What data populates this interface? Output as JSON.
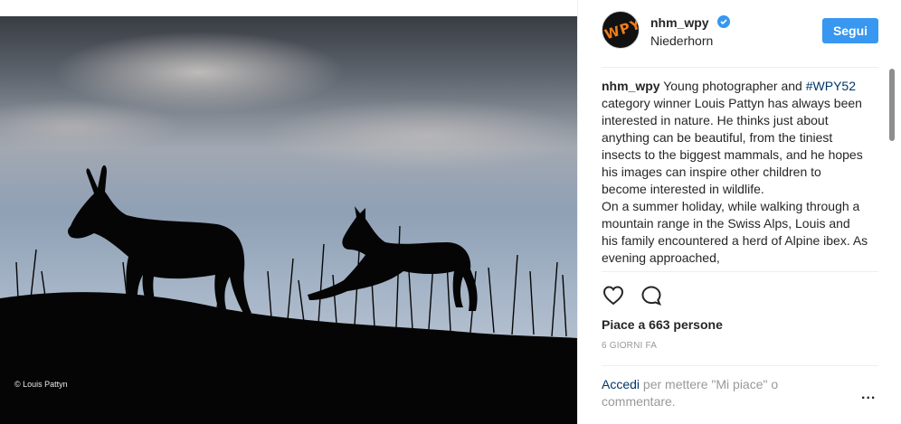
{
  "photo": {
    "credit": "© Louis Pattyn"
  },
  "post": {
    "avatar_text": "WPY",
    "username": "nhm_wpy",
    "verified_icon": "verified-badge-icon",
    "location": "Niederhorn",
    "follow_label": "Segui",
    "caption": {
      "user": "nhm_wpy",
      "lead": " Young photographer and ",
      "hashtag": "#WPY52",
      "body1": " category winner Louis Pattyn has always been interested in nature. He thinks just about anything can be beautiful, from the tiniest insects to the biggest mammals, and he hopes his images can inspire other children to become interested in wildlife.",
      "body2": "On a summer holiday, while walking through a mountain range in the Swiss Alps, Louis and his family encountered a herd of Alpine ibex. As evening approached,"
    },
    "likes": "Piace a 663 persone",
    "timestamp": "6 GIORNI FA",
    "login_link": "Accedi",
    "login_rest": " per mettere \"Mi piace\" o commentare.",
    "more_label": "..."
  },
  "colors": {
    "accent": "#3897f0",
    "link": "#003569",
    "avatar_orange": "#ef7d1a"
  }
}
